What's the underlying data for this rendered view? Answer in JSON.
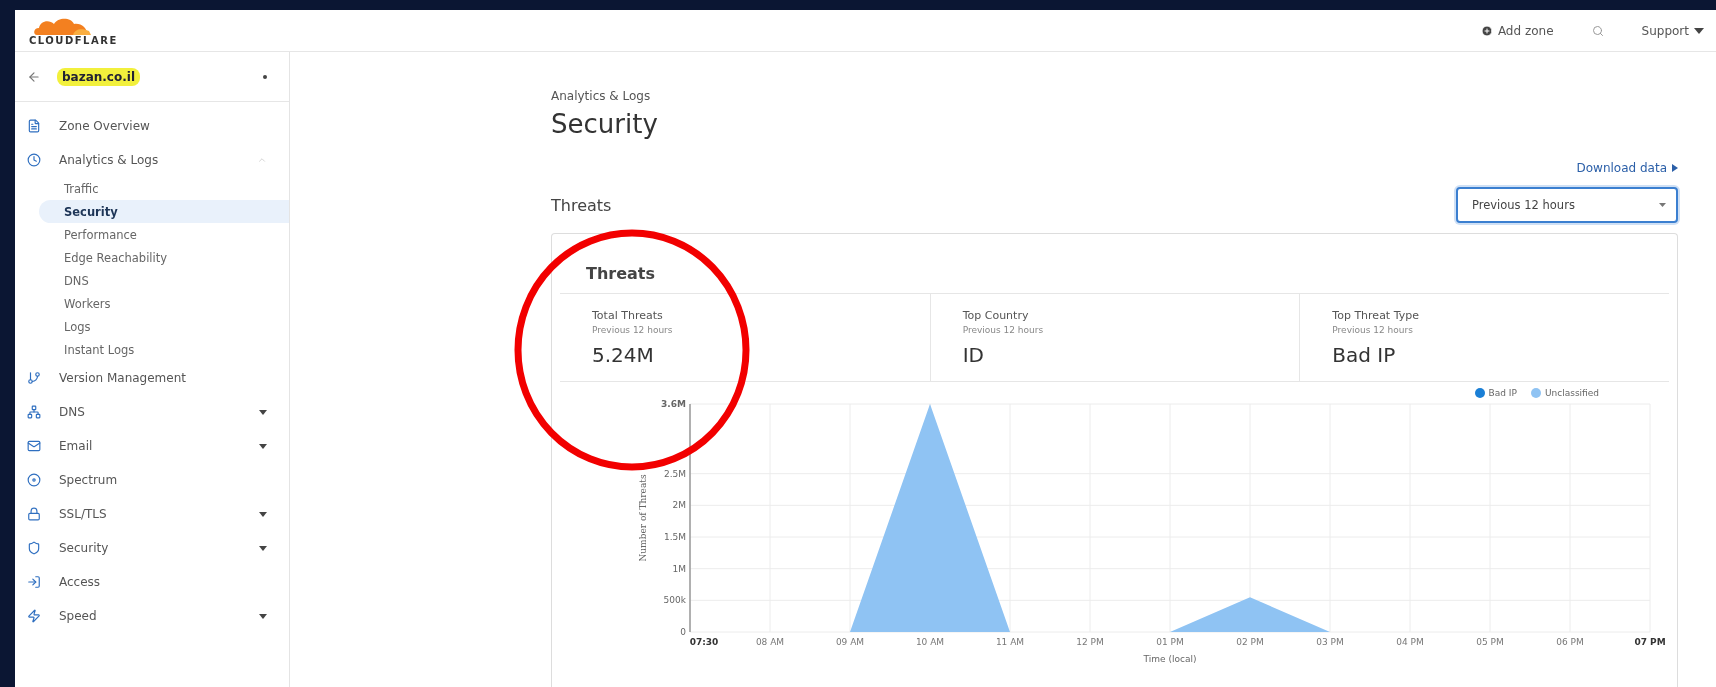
{
  "header": {
    "logo": "CLOUDFLARE",
    "actions": [
      {
        "kind": "add",
        "label": "Add zone"
      },
      {
        "kind": "search"
      },
      {
        "kind": "menu",
        "label": "Support"
      }
    ]
  },
  "sidebar": {
    "zone": {
      "name": "bazan.co.il",
      "highlighted": true
    },
    "items": [
      {
        "label": "Zone Overview",
        "collapsible": false
      },
      {
        "label": "Analytics & Logs",
        "collapsible": true,
        "expanded": true,
        "children": [
          {
            "label": "Traffic",
            "selected": false
          },
          {
            "label": "Security",
            "selected": true
          },
          {
            "label": "Performance",
            "selected": false
          },
          {
            "label": "Edge Reachability",
            "selected": false
          },
          {
            "label": "DNS",
            "selected": false
          },
          {
            "label": "Workers",
            "selected": false
          },
          {
            "label": "Logs",
            "selected": false
          },
          {
            "label": "Instant Logs",
            "selected": false
          }
        ]
      },
      {
        "label": "Version Management",
        "collapsible": false
      },
      {
        "label": "DNS",
        "collapsible": true,
        "expanded": false
      },
      {
        "label": "Email",
        "collapsible": true,
        "expanded": false
      },
      {
        "label": "Spectrum",
        "collapsible": false
      },
      {
        "label": "SSL/TLS",
        "collapsible": true,
        "expanded": false
      },
      {
        "label": "Security",
        "collapsible": true,
        "expanded": false
      },
      {
        "label": "Access",
        "collapsible": false
      },
      {
        "label": "Speed",
        "collapsible": true,
        "expanded": false
      }
    ]
  },
  "main": {
    "breadcrumb": "Analytics & Logs",
    "title": "Security",
    "download_link": "Download data",
    "section_title": "Threats",
    "period_select": {
      "value": "Previous 12 hours"
    },
    "card": {
      "title": "Threats",
      "stats": [
        {
          "label": "Total Threats",
          "sublabel": "Previous 12 hours",
          "value": "5.24M"
        },
        {
          "label": "Top Country",
          "sublabel": "Previous 12 hours",
          "value": "ID"
        },
        {
          "label": "Top Threat Type",
          "sublabel": "Previous 12 hours",
          "value": "Bad IP"
        }
      ],
      "chart_data": {
        "type": "area",
        "xlabel": "Time (local)",
        "ylabel": "Number of Threats",
        "grid": true,
        "categories": [
          "07:30",
          "08 AM",
          "09 AM",
          "10 AM",
          "11 AM",
          "12 PM",
          "01 PM",
          "02 PM",
          "03 PM",
          "04 PM",
          "05 PM",
          "06 PM",
          "07 PM"
        ],
        "series": [
          {
            "name": "Bad IP",
            "color": "#1a7fd6",
            "values": [
              null,
              null,
              null,
              null,
              null,
              null,
              null,
              null,
              null,
              null,
              null,
              null,
              null
            ]
          },
          {
            "name": "Unclassified",
            "color": "#8fc3f3",
            "values": [
              0,
              0,
              0,
              3600000,
              0,
              0,
              0,
              550000,
              0,
              0,
              0,
              0,
              0
            ]
          }
        ],
        "ylim": [
          0,
          3600000
        ],
        "yticks": [
          {
            "value": 0,
            "label": "0"
          },
          {
            "value": 500000,
            "label": "500k"
          },
          {
            "value": 1000000,
            "label": "1M"
          },
          {
            "value": 1500000,
            "label": "1.5M"
          },
          {
            "value": 2000000,
            "label": "2M"
          },
          {
            "value": 2500000,
            "label": "2.5M"
          },
          {
            "value": 3600000,
            "label": "3.6M"
          }
        ]
      }
    }
  }
}
